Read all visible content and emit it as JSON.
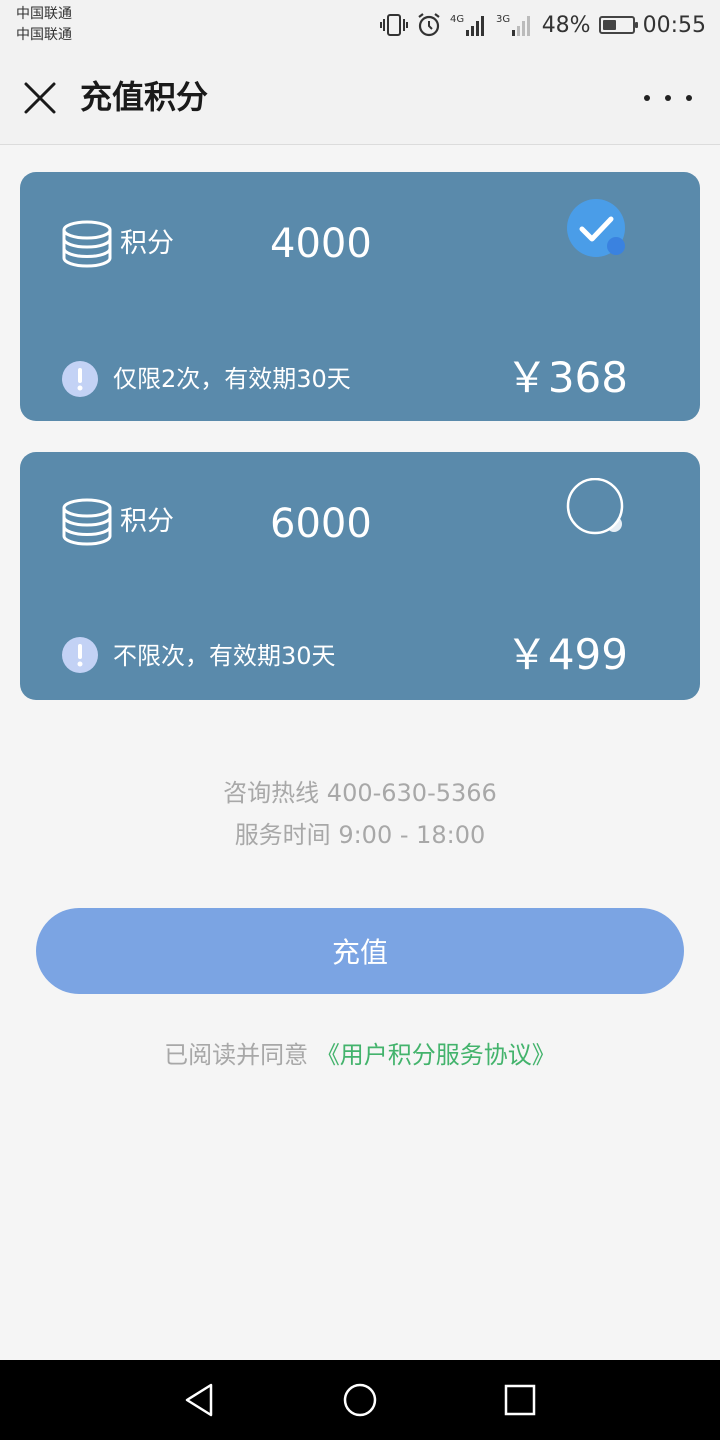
{
  "status_bar": {
    "carrier_1": "中国联通",
    "carrier_2": "中国联通",
    "network_1": "4G",
    "network_2": "3G",
    "battery": "48%",
    "battery_level": 0.48,
    "time": "00:55"
  },
  "header": {
    "title": "充值积分",
    "close_icon": "close-icon",
    "more_icon": "more-icon"
  },
  "cards": [
    {
      "label": "积分",
      "points": "4000",
      "selected": true,
      "desc": "仅限2次，有效期30天",
      "price": "￥368"
    },
    {
      "label": "积分",
      "points": "6000",
      "selected": false,
      "desc": "不限次，有效期30天",
      "price": "￥499"
    }
  ],
  "hotline": {
    "phone": "咨询热线 400-630-5366",
    "hours": "服务时间 9:00 - 18:00"
  },
  "recharge_button": "充值",
  "agreement": {
    "text": "已阅读并同意",
    "link": "《用户积分服务协议》"
  },
  "colors": {
    "card_bg": "#5a8aab",
    "button_bg": "#7ba4e3",
    "link": "#43b36c",
    "checked": "#4a9de8"
  }
}
